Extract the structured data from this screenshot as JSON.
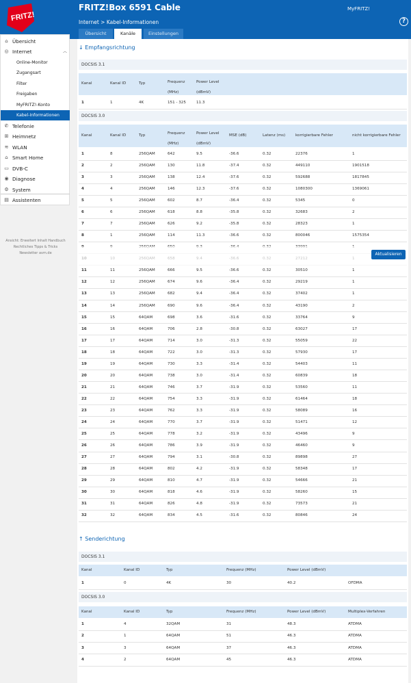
{
  "header": {
    "title": "FRITZ!Box 6591 Cable",
    "myfritz": "MyFRITZ!",
    "breadcrumb": "Internet > Kabel-Informationen",
    "help": "?",
    "tabs": [
      "Übersicht",
      "Kanäle",
      "Einstellungen"
    ],
    "logo_text": "FRITZ!"
  },
  "sidebar": {
    "items": [
      {
        "label": "Übersicht",
        "icon": "home-icon"
      },
      {
        "label": "Internet",
        "icon": "globe-icon"
      },
      {
        "label": "Online-Monitor",
        "sub": true
      },
      {
        "label": "Zugangsart",
        "sub": true
      },
      {
        "label": "Filter",
        "sub": true
      },
      {
        "label": "Freigaben",
        "sub": true
      },
      {
        "label": "MyFRITZ!-Konto",
        "sub": true
      },
      {
        "label": "Kabel-Informationen",
        "sub": true,
        "selected": true
      },
      {
        "label": "Telefonie",
        "icon": "phone-icon"
      },
      {
        "label": "Heimnetz",
        "icon": "network-icon"
      },
      {
        "label": "WLAN",
        "icon": "wifi-icon"
      },
      {
        "label": "Smart Home",
        "icon": "smarthome-icon"
      },
      {
        "label": "DVB-C",
        "icon": "tv-icon"
      },
      {
        "label": "Diagnose",
        "icon": "diagnose-icon"
      },
      {
        "label": "System",
        "icon": "system-icon"
      },
      {
        "label": "Assistenten",
        "icon": "wizard-icon"
      }
    ],
    "footer": [
      "Ansicht: Erweitert",
      "Inhalt",
      "Handbuch",
      "Rechtliches",
      "Tipps & Tricks",
      "Newsletter",
      "avm.de"
    ]
  },
  "down": {
    "title": "↓ Empfangsrichtung",
    "docsis31_label": "DOCSIS 3.1",
    "docsis31_headers": [
      "Kanal",
      "Kanal ID",
      "Typ",
      "Frequenz (MHz)",
      "Power Level (dBmV)"
    ],
    "docsis31_rows": [
      [
        "1",
        "1",
        "4K",
        "151 - 325",
        "11.3"
      ]
    ],
    "docsis30_label": "DOCSIS 3.0",
    "docsis30_headers": [
      "Kanal",
      "Kanal ID",
      "Typ",
      "Frequenz (MHz)",
      "Power Level (dBmV)",
      "MSE (dB)",
      "Latenz (ms)",
      "korrigierbare Fehler",
      "nicht korrigierbare Fehler"
    ],
    "docsis30_rows": [
      [
        "1",
        "8",
        "256QAM",
        "642",
        "9.5",
        "-36.6",
        "0.32",
        "22376",
        "1"
      ],
      [
        "2",
        "2",
        "256QAM",
        "130",
        "11.8",
        "-37.4",
        "0.32",
        "449110",
        "1901518"
      ],
      [
        "3",
        "3",
        "256QAM",
        "138",
        "12.4",
        "-37.6",
        "0.32",
        "592688",
        "1817845"
      ],
      [
        "4",
        "4",
        "256QAM",
        "146",
        "12.3",
        "-37.6",
        "0.32",
        "1080300",
        "1369061"
      ],
      [
        "5",
        "5",
        "256QAM",
        "602",
        "8.7",
        "-36.4",
        "0.32",
        "5345",
        "0"
      ],
      [
        "6",
        "6",
        "256QAM",
        "618",
        "8.8",
        "-35.8",
        "0.32",
        "32683",
        "2"
      ],
      [
        "7",
        "7",
        "256QAM",
        "626",
        "9.2",
        "-35.8",
        "0.32",
        "28323",
        "1"
      ],
      [
        "8",
        "1",
        "256QAM",
        "114",
        "11.3",
        "-36.6",
        "0.32",
        "800046",
        "1575354"
      ],
      [
        "9",
        "9",
        "256QAM",
        "650",
        "9.3",
        "-36.4",
        "0.32",
        "33991",
        "1"
      ],
      [
        "10",
        "10",
        "256QAM",
        "658",
        "9.4",
        "-36.6",
        "0.32",
        "27212",
        "1"
      ],
      [
        "11",
        "11",
        "256QAM",
        "666",
        "9.5",
        "-36.6",
        "0.32",
        "30510",
        "1"
      ],
      [
        "12",
        "12",
        "256QAM",
        "674",
        "9.6",
        "-36.4",
        "0.32",
        "29219",
        "1"
      ],
      [
        "13",
        "13",
        "256QAM",
        "682",
        "9.4",
        "-36.4",
        "0.32",
        "37402",
        "1"
      ],
      [
        "14",
        "14",
        "256QAM",
        "690",
        "9.6",
        "-36.4",
        "0.32",
        "43190",
        "2"
      ],
      [
        "15",
        "15",
        "64QAM",
        "698",
        "3.6",
        "-31.6",
        "0.32",
        "33764",
        "9"
      ],
      [
        "16",
        "16",
        "64QAM",
        "706",
        "2.8",
        "-30.8",
        "0.32",
        "63027",
        "17"
      ],
      [
        "17",
        "17",
        "64QAM",
        "714",
        "3.0",
        "-31.3",
        "0.32",
        "55059",
        "22"
      ],
      [
        "18",
        "18",
        "64QAM",
        "722",
        "3.0",
        "-31.3",
        "0.32",
        "57930",
        "17"
      ],
      [
        "19",
        "19",
        "64QAM",
        "730",
        "3.3",
        "-31.4",
        "0.32",
        "54403",
        "11"
      ],
      [
        "20",
        "20",
        "64QAM",
        "738",
        "3.0",
        "-31.4",
        "0.32",
        "60839",
        "18"
      ],
      [
        "21",
        "21",
        "64QAM",
        "746",
        "3.7",
        "-31.9",
        "0.32",
        "53560",
        "11"
      ],
      [
        "22",
        "22",
        "64QAM",
        "754",
        "3.3",
        "-31.9",
        "0.32",
        "61464",
        "18"
      ],
      [
        "23",
        "23",
        "64QAM",
        "762",
        "3.3",
        "-31.9",
        "0.32",
        "58089",
        "16"
      ],
      [
        "24",
        "24",
        "64QAM",
        "770",
        "3.7",
        "-31.9",
        "0.32",
        "51471",
        "12"
      ],
      [
        "25",
        "25",
        "64QAM",
        "778",
        "3.2",
        "-31.9",
        "0.32",
        "43496",
        "9"
      ],
      [
        "26",
        "26",
        "64QAM",
        "786",
        "3.9",
        "-31.9",
        "0.32",
        "46460",
        "9"
      ],
      [
        "27",
        "27",
        "64QAM",
        "794",
        "3.1",
        "-30.8",
        "0.32",
        "89898",
        "27"
      ],
      [
        "28",
        "28",
        "64QAM",
        "802",
        "4.2",
        "-31.9",
        "0.32",
        "58348",
        "17"
      ],
      [
        "29",
        "29",
        "64QAM",
        "810",
        "4.7",
        "-31.9",
        "0.32",
        "54666",
        "21"
      ],
      [
        "30",
        "30",
        "64QAM",
        "818",
        "4.6",
        "-31.9",
        "0.32",
        "58260",
        "15"
      ],
      [
        "31",
        "31",
        "64QAM",
        "826",
        "4.8",
        "-31.9",
        "0.32",
        "73573",
        "21"
      ],
      [
        "32",
        "32",
        "64QAM",
        "834",
        "4.5",
        "-31.6",
        "0.32",
        "80846",
        "24"
      ]
    ]
  },
  "up": {
    "title": "↑ Senderichtung",
    "docsis31_label": "DOCSIS 3.1",
    "docsis31_headers": [
      "Kanal",
      "Kanal ID",
      "Typ",
      "Frequenz (MHz)",
      "Power Level (dBmV)",
      ""
    ],
    "docsis31_rows": [
      [
        "1",
        "0",
        "4K",
        "30",
        "40.2",
        "OFDMA"
      ]
    ],
    "docsis30_label": "DOCSIS 3.0",
    "docsis30_headers": [
      "Kanal",
      "Kanal ID",
      "Typ",
      "Frequenz (MHz)",
      "Power Level (dBmV)",
      "Multiplex-Verfahren"
    ],
    "docsis30_rows": [
      [
        "1",
        "4",
        "32QAM",
        "31",
        "48.3",
        "ATDMA"
      ],
      [
        "2",
        "1",
        "64QAM",
        "51",
        "46.3",
        "ATDMA"
      ],
      [
        "3",
        "3",
        "64QAM",
        "37",
        "46.3",
        "ATDMA"
      ],
      [
        "4",
        "2",
        "64QAM",
        "45",
        "46.3",
        "ATDMA"
      ]
    ]
  },
  "refresh_label": "Aktualisieren",
  "colors": {
    "brand": "#0d64b4",
    "header_row": "#d8e8f7"
  }
}
